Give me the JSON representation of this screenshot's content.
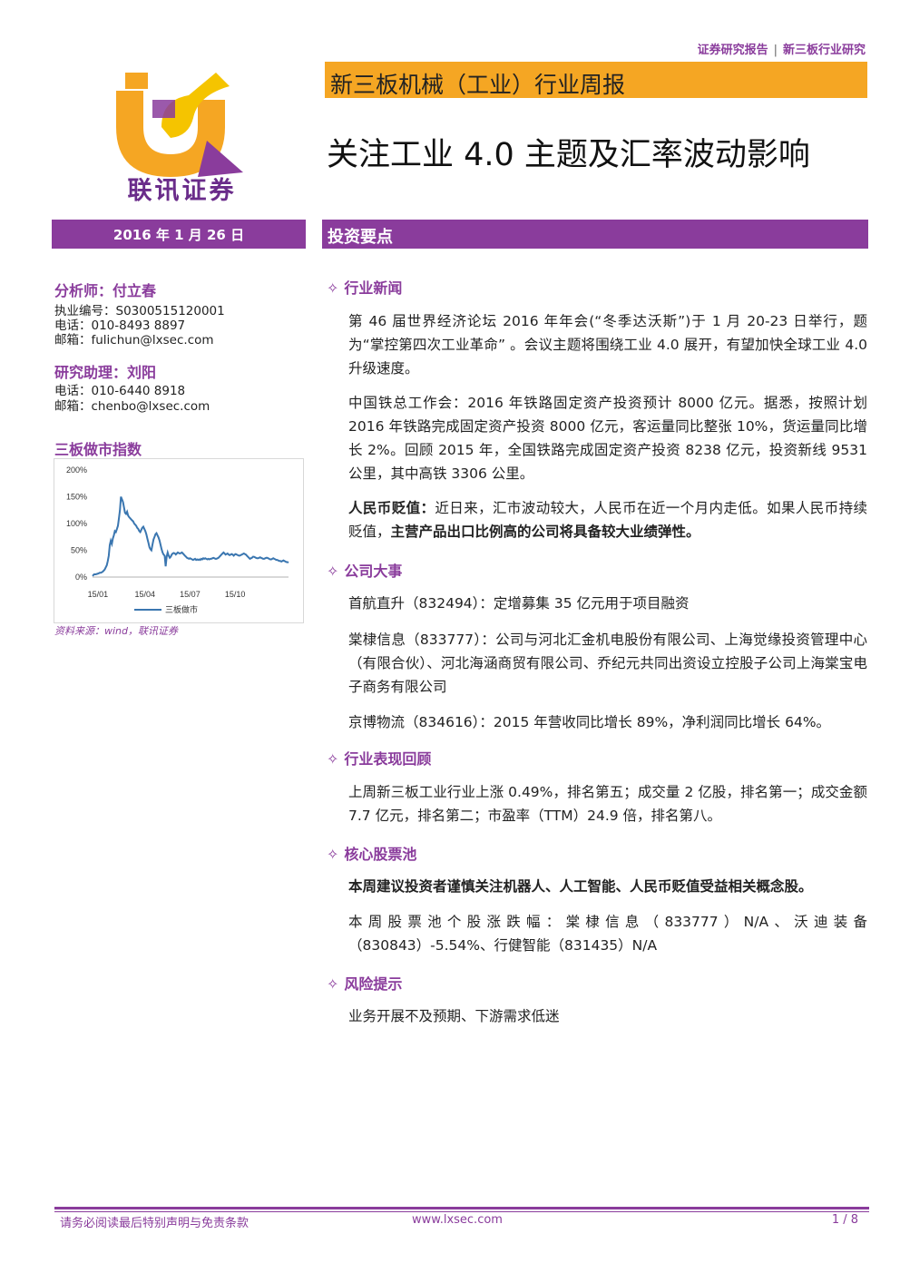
{
  "header": {
    "category": "证券研究报告",
    "separator": "|",
    "subcategory": "新三板行业研究",
    "logo_text": "联讯证券",
    "banner": "新三板机械（工业）行业周报",
    "title": "关注工业 4.0 主题及汇率波动影响",
    "date": "2016 年 1 月 26 日",
    "section_label": "投资要点"
  },
  "colors": {
    "purple": "#8a3c9c",
    "orange": "#f5a623",
    "line_blue": "#3a76b0"
  },
  "analyst": {
    "title": "分析师：付立春",
    "cert": "执业编号：S0300515120001",
    "phone": "电话：010-8493 8897",
    "email": "邮箱：fulichun@lxsec.com"
  },
  "assistant": {
    "title": "研究助理：刘阳",
    "phone": "电话：010-6440 8918",
    "email": "邮箱：chenbo@lxsec.com"
  },
  "chart": {
    "title": "三板做市指数",
    "source": "资料来源：wind，联讯证券",
    "chart_data": {
      "type": "line",
      "title": "",
      "xlabel": "",
      "ylabel": "",
      "ylim": [
        0,
        200
      ],
      "yticks": [
        "200%",
        "150%",
        "100%",
        "50%",
        "0%"
      ],
      "xticks": [
        "15/01",
        "15/04",
        "15/07",
        "15/10"
      ],
      "legend": "bottom",
      "grid": false,
      "series": [
        {
          "name": "三板做市",
          "color": "#3a76b0",
          "x": [
            0,
            3,
            6,
            9,
            12,
            14,
            16,
            18,
            20,
            22,
            24,
            26,
            28,
            30,
            32,
            34,
            36,
            38,
            40,
            42,
            44,
            46,
            48,
            50,
            52,
            54,
            56,
            58,
            60,
            62,
            64,
            66,
            68,
            70,
            72,
            74,
            76,
            78,
            80,
            82,
            84,
            86,
            88,
            90,
            92,
            94,
            96,
            98,
            100,
            102,
            104,
            106,
            108,
            110,
            112,
            114,
            116,
            118,
            120,
            122,
            124,
            126,
            128,
            130,
            132,
            134,
            136,
            138,
            140,
            142,
            144,
            146,
            148,
            150,
            152,
            154,
            156,
            158,
            160,
            162,
            164,
            166,
            168,
            170,
            172,
            174,
            176,
            178,
            180,
            182,
            184,
            186,
            188,
            190,
            192,
            194,
            196,
            198,
            200,
            202,
            204,
            206,
            208,
            210,
            212,
            214,
            216,
            218,
            220,
            222,
            224,
            226,
            228,
            230,
            232,
            234,
            236,
            238,
            240,
            242,
            244,
            246,
            248,
            250,
            252,
            254,
            256,
            258,
            260,
            262,
            264,
            266,
            268,
            270,
            272,
            274,
            276,
            278,
            280,
            282,
            284,
            286,
            288,
            290,
            292,
            294,
            296,
            298,
            300,
            302,
            304,
            306,
            308,
            310,
            312,
            314,
            316,
            318,
            320,
            322,
            324,
            326,
            328,
            330,
            332,
            334,
            336,
            338,
            340,
            342,
            344,
            346,
            348,
            350,
            352,
            354,
            356,
            358,
            360,
            362,
            364,
            366,
            368,
            370,
            372,
            374,
            376,
            378,
            380,
            382,
            384,
            386
          ],
          "values": [
            2,
            5,
            5,
            6,
            7,
            8,
            8,
            9,
            10,
            12,
            14,
            18,
            22,
            30,
            40,
            60,
            68,
            62,
            72,
            78,
            86,
            84,
            90,
            96,
            110,
            125,
            150,
            145,
            140,
            130,
            120,
            118,
            122,
            115,
            112,
            110,
            108,
            106,
            104,
            100,
            98,
            96,
            92,
            90,
            86,
            84,
            88,
            92,
            94,
            90,
            86,
            80,
            72,
            64,
            56,
            52,
            50,
            60,
            70,
            75,
            80,
            82,
            78,
            74,
            68,
            60,
            52,
            46,
            42,
            40,
            20,
            38,
            46,
            40,
            36,
            38,
            42,
            44,
            45,
            44,
            42,
            44,
            46,
            45,
            44,
            45,
            46,
            44,
            42,
            40,
            38,
            36,
            35,
            34,
            35,
            34,
            33,
            32,
            33,
            34,
            32,
            33,
            32,
            33,
            32,
            34,
            33,
            35,
            34,
            35,
            34,
            33,
            34,
            33,
            34,
            34,
            35,
            36,
            35,
            34,
            34,
            35,
            36,
            38,
            40,
            42,
            44,
            46,
            44,
            42,
            43,
            44,
            42,
            41,
            42,
            43,
            42,
            40,
            42,
            43,
            42,
            41,
            40,
            40,
            41,
            42,
            43,
            44,
            43,
            42,
            40,
            38,
            36,
            34,
            35,
            36,
            38,
            38,
            37,
            36,
            35,
            35,
            36,
            37,
            36,
            35,
            34,
            34,
            35,
            36,
            36,
            35,
            34,
            33,
            33,
            34,
            35,
            34,
            33,
            32,
            32,
            31,
            30,
            30,
            29,
            30,
            31,
            30,
            29,
            28,
            28,
            27,
            27
          ]
        }
      ]
    }
  },
  "sections": [
    {
      "heading": "行业新闻",
      "paragraphs": [
        "第 46 届世界经济论坛 2016 年年会(“冬季达沃斯”)于 1 月 20-23 日举行，题为“掌控第四次工业革命” 。会议主题将围绕工业 4.0 展开，有望加快全球工业 4.0 升级速度。",
        "中国铁总工作会：2016 年铁路固定资产投资预计 8000 亿元。据悉，按照计划 2016 年铁路完成固定资产投资 8000 亿元，客运量同比整张 10%，货运量同比增长 2%。回顾 2015 年，全国铁路完成固定资产投资 8238 亿元，投资新线 9531 公里，其中高铁 3306 公里。"
      ],
      "rmb": {
        "label": "人民币贬值：",
        "text": "近日来，汇市波动较大，人民币在近一个月内走低。如果人民币持续贬值，",
        "emph": "主营产品出口比例高的公司将具备较大业绩弹性。"
      }
    },
    {
      "heading": "公司大事",
      "paragraphs": [
        "首航直升（832494）：定增募集 35 亿元用于项目融资",
        "棠棣信息（833777）：公司与河北汇金机电股份有限公司、上海觉缘投资管理中心（有限合伙）、河北海涵商贸有限公司、乔纪元共同出资设立控股子公司上海棠宝电子商务有限公司",
        "京博物流（834616）：2015 年营收同比增长 89%，净利润同比增长 64%。"
      ]
    },
    {
      "heading": "行业表现回顾",
      "paragraphs": [
        "上周新三板工业行业上涨 0.49%，排名第五；成交量 2 亿股，排名第一；成交金额 7.7 亿元，排名第二；市盈率（TTM）24.9 倍，排名第八。"
      ]
    },
    {
      "heading": "核心股票池",
      "bold_para": "本周建议投资者谨慎关注机器人、人工智能、人民币贬值受益相关概念股。",
      "paragraphs": [
        "本周股票池个股涨跌幅：棠棣信息（833777）N/A、沃迪装备（830843）-5.54%、行健智能（831435）N/A"
      ]
    },
    {
      "heading": "风险提示",
      "paragraphs": [
        "业务开展不及预期、下游需求低迷"
      ]
    }
  ],
  "bullet_icon": "✧",
  "footer": {
    "notice": "请务必阅读最后特别声明与免责条款",
    "url": "www.lxsec.com",
    "page": "1 / 8"
  }
}
